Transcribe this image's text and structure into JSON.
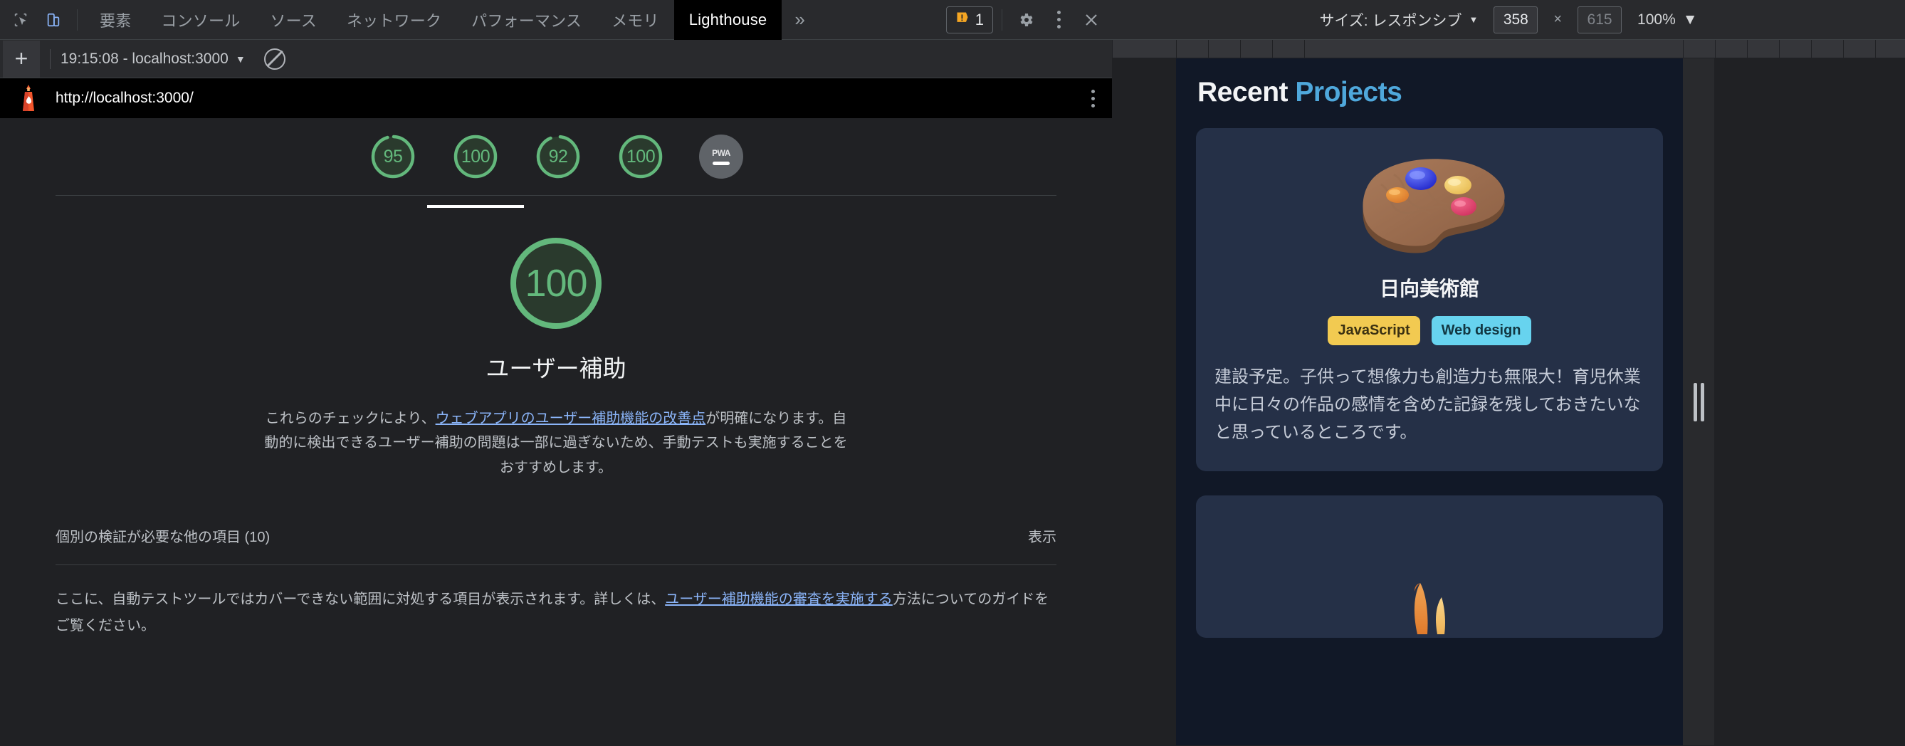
{
  "devtools": {
    "toolbar": {
      "inspect_icon": "inspect-cursor-icon",
      "device_icon": "device-toolbar-icon",
      "tabs": [
        {
          "label": "要素",
          "active": false
        },
        {
          "label": "コンソール",
          "active": false
        },
        {
          "label": "ソース",
          "active": false
        },
        {
          "label": "ネットワーク",
          "active": false
        },
        {
          "label": "パフォーマンス",
          "active": false
        },
        {
          "label": "メモリ",
          "active": false
        },
        {
          "label": "Lighthouse",
          "active": true
        }
      ],
      "more_tabs": "»",
      "warning_count": "1",
      "warning_icon": "warning-badge-icon",
      "settings_icon": "gear-icon",
      "more_icon": "kebab-menu-icon",
      "close_icon": "close-icon"
    },
    "runbar": {
      "add_label": "+",
      "run_selector": "19:15:08 - localhost:3000",
      "caret": "▼",
      "clear_icon": "no-entry-clear-icon"
    },
    "report": {
      "lighthouse_icon": "lighthouse-logo-icon",
      "url": "http://localhost:3000/",
      "options_icon": "kebab-menu-icon",
      "gauges": [
        {
          "score": "95",
          "selected": false,
          "name": "performance"
        },
        {
          "score": "100",
          "selected": true,
          "name": "accessibility"
        },
        {
          "score": "92",
          "selected": false,
          "name": "best-practices"
        },
        {
          "score": "100",
          "selected": false,
          "name": "seo"
        }
      ],
      "pwa": {
        "label": "PWA",
        "value": "—"
      },
      "category": {
        "score": "100",
        "title": "ユーザー補助",
        "desc_part1": "これらのチェックにより、",
        "desc_link": "ウェブアプリのユーザー補助機能の改善点",
        "desc_part2": "が明確になります。自動的に検出できるユーザー補助の問題は一部に過ぎないため、手動テストも実施することをおすすめします。"
      },
      "manual": {
        "heading": "個別の検証が必要な他の項目 (10)",
        "toggle": "表示",
        "body_part1": "ここに、自動テストツールではカバーできない範囲に対処する項目が表示されます。詳しくは、",
        "body_link": "ユーザー補助機能の審査を実施する",
        "body_part2": "方法についてのガイドをご覧ください。"
      }
    }
  },
  "emulation": {
    "toolbar": {
      "size_label": "サイズ: レスポンシブ",
      "size_caret": "▼",
      "width": "358",
      "x": "×",
      "height": "615",
      "zoom": "100%",
      "zoom_caret": "▼"
    },
    "resize_handle": "device-resize-handle",
    "page": {
      "title_word1": "Recent",
      "title_word2": "Projects",
      "cards": [
        {
          "image": "artist-palette-3d-illustration",
          "title": "日向美術館",
          "tags": [
            {
              "label": "JavaScript",
              "color": "#f2ca51"
            },
            {
              "label": "Web design",
              "color": "#67d3ef"
            }
          ],
          "body": "建設予定。子供って想像力も創造力も無限大！育児休業中に日々の作品の感情を含めた記録を残しておきたいなと思っているところです。"
        },
        {
          "image": "fox-3d-illustration"
        }
      ]
    }
  },
  "colors": {
    "score_green": "#63b87c",
    "link_blue": "#8ab4f8",
    "page_bg": "#111827",
    "card_bg": "#253047",
    "accent_blue": "#4fa8dc"
  }
}
